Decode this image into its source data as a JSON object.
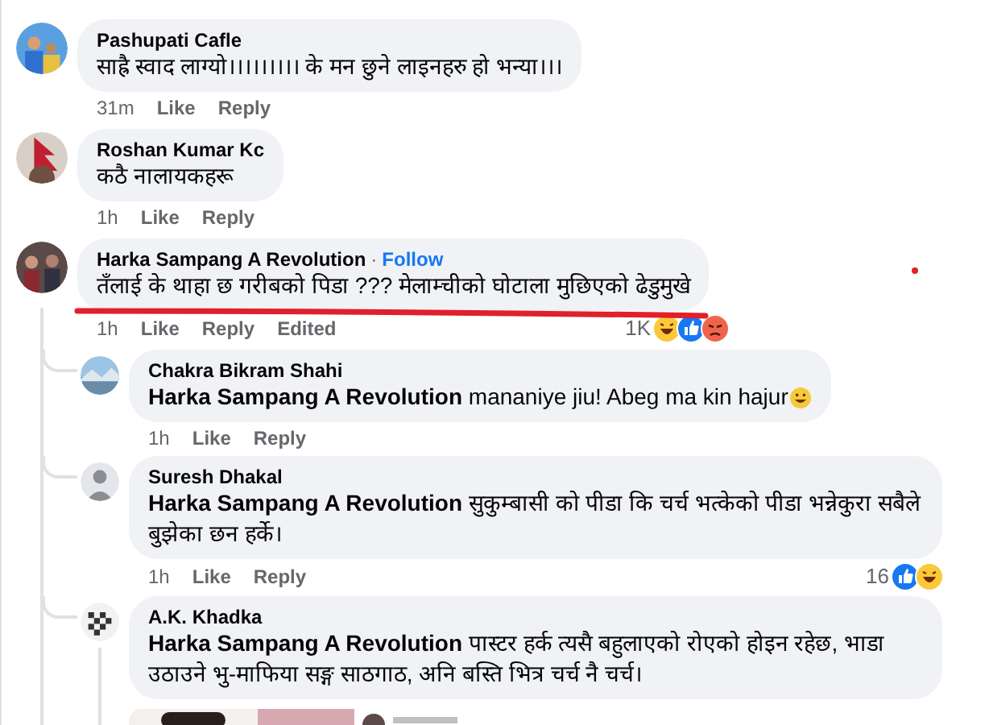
{
  "comments": [
    {
      "name": "Pashupati Cafle",
      "text": "साह्रै स्वाद लाग्यो।।।।।।।।। के मन छुने लाइनहरु हो भन्या।।।",
      "time": "31m",
      "actions": [
        "Like",
        "Reply"
      ],
      "avatar": {
        "kind": "family"
      }
    },
    {
      "name": "Roshan Kumar Kc",
      "text": "कठै नालायकहरू",
      "time": "1h",
      "actions": [
        "Like",
        "Reply"
      ],
      "avatar": {
        "kind": "flag"
      }
    },
    {
      "name": "Harka Sampang A Revolution",
      "separator": "·",
      "follow": "Follow",
      "text": "तँलाई के थाहा छ गरीबको पिडा ??? मेलाम्चीको घोटाला मुछिएको ढेडुमुखे",
      "time": "1h",
      "actions": [
        "Like",
        "Reply"
      ],
      "edited": "Edited",
      "avatar": {
        "kind": "group"
      },
      "underlined": true,
      "reactions": {
        "count": "1K",
        "icons": [
          {
            "kind": "haha"
          },
          {
            "kind": "like"
          },
          {
            "kind": "angry"
          }
        ]
      },
      "replies": [
        {
          "name": "Chakra Bikram Shahi",
          "mention": "Harka Sampang A Revolution",
          "text": "mananiye jiu! Abeg ma kin hajur",
          "trailing_icon": {
            "kind": "grin"
          },
          "time": "1h",
          "actions": [
            "Like",
            "Reply"
          ],
          "avatar": {
            "kind": "landscape"
          }
        },
        {
          "name": "Suresh Dhakal",
          "mention": "Harka Sampang A Revolution",
          "text": "सुकुम्बासी को पीडा कि चर्च भत्केको पीडा भन्नेकुरा सबैले बुझेका छन हर्के।",
          "time": "1h",
          "actions": [
            "Like",
            "Reply"
          ],
          "avatar": {
            "kind": "default"
          },
          "reactions": {
            "count": "16",
            "icons": [
              {
                "kind": "like"
              },
              {
                "kind": "haha"
              }
            ]
          }
        },
        {
          "name": "A.K. Khadka",
          "mention": "Harka Sampang A Revolution",
          "text": "पास्टर हर्क त्यसै बहुलाएको रोएको होइन रहेछ, भाडा उठाउने भु-माफिया सङ्ग साठगाठ, अनि बस्ति भित्र चर्च नै चर्च।",
          "avatar": {
            "kind": "chess"
          }
        }
      ]
    }
  ],
  "annotation_dot": true
}
